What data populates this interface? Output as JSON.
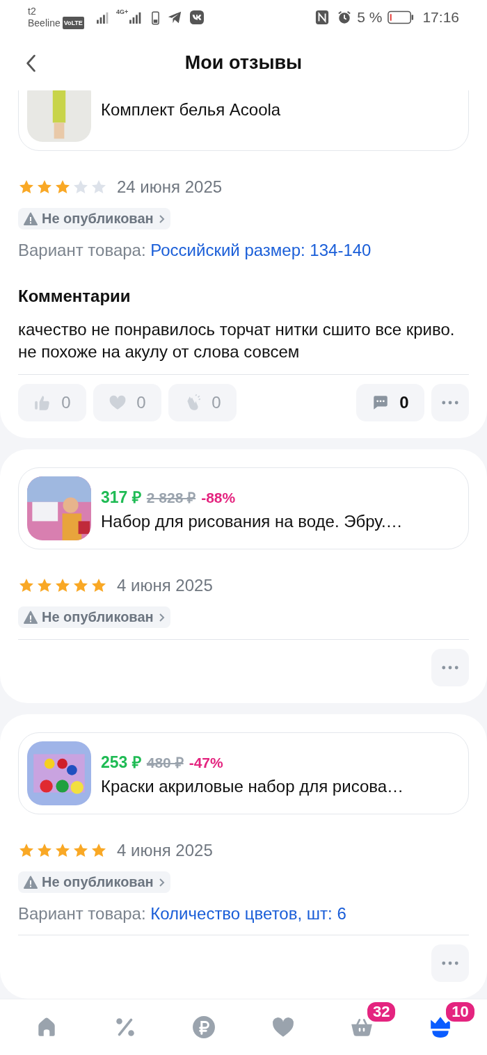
{
  "status_bar": {
    "carrier_1": "t2",
    "carrier_2": "Beeline",
    "volte": "VoLTE",
    "network": "4G+",
    "battery": "5 %",
    "time": "17:16"
  },
  "header": {
    "title": "Мои отзывы"
  },
  "reviews": [
    {
      "product": {
        "name": "Комплект белья Acoola"
      },
      "stars": 3,
      "date": "24 июня 2025",
      "status": "Не опубликован",
      "variant_label": "Вариант товара:",
      "variant_value": "Российский размер: 134-140",
      "comments_title": "Комментарии",
      "comment": "качество не понравилось торчат нитки сшито все криво. не похоже на акулу от слова совсем",
      "reactions": [
        {
          "kind": "like",
          "count": "0"
        },
        {
          "kind": "heart",
          "count": "0"
        },
        {
          "kind": "clap",
          "count": "0"
        }
      ],
      "comments_count": "0"
    },
    {
      "product": {
        "price": "317 ₽",
        "old_price": "2 828 ₽",
        "discount": "-88%",
        "name": "Набор для рисования на воде. Эбру.…"
      },
      "stars": 5,
      "date": "4 июня 2025",
      "status": "Не опубликован"
    },
    {
      "product": {
        "price": "253 ₽",
        "old_price": "480 ₽",
        "discount": "-47%",
        "name": "Краски акриловые набор для рисова…"
      },
      "stars": 5,
      "date": "4 июня 2025",
      "status": "Не опубликован",
      "variant_label": "Вариант товара:",
      "variant_value": "Количество цветов, шт: 6"
    }
  ],
  "bottom_nav": [
    {
      "kind": "home",
      "selected": false
    },
    {
      "kind": "percent",
      "selected": false
    },
    {
      "kind": "ruble",
      "selected": false
    },
    {
      "kind": "heart",
      "selected": false
    },
    {
      "kind": "basket",
      "selected": false,
      "badge": "32"
    },
    {
      "kind": "profile",
      "selected": true,
      "badge": "10"
    }
  ]
}
